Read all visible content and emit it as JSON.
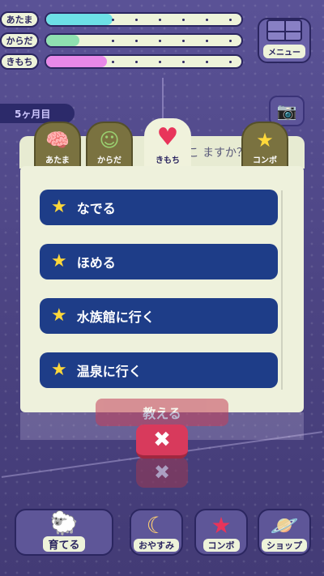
{
  "stats": [
    {
      "label": "あたま",
      "fill": 0.34,
      "color": "#6de0e6"
    },
    {
      "label": "からだ",
      "fill": 0.17,
      "color": "#8fe0b0"
    },
    {
      "label": "きもち",
      "fill": 0.31,
      "color": "#e888e8"
    }
  ],
  "menu": {
    "label": "メニュー",
    "icon": "grid-icon"
  },
  "month": {
    "label": "5ヶ月目"
  },
  "camera": {
    "icon": "camera-icon"
  },
  "question": {
    "text": "こ    ますか？"
  },
  "tabs": [
    {
      "label": "あたま",
      "icon": "brain-icon",
      "glyph": "🧠",
      "active": false
    },
    {
      "label": "からだ",
      "icon": "face-icon",
      "glyph": "☺",
      "active": false
    },
    {
      "label": "きもち",
      "icon": "heart-icon",
      "glyph": "♥",
      "active": true
    },
    {
      "label": "コンボ",
      "icon": "stars-icon",
      "glyph": "★",
      "active": false
    }
  ],
  "options": [
    {
      "label": "なでる",
      "icon": "star-icon"
    },
    {
      "label": "ほめる",
      "icon": "star-icon"
    },
    {
      "label": "水族館に行く",
      "icon": "star-icon"
    },
    {
      "label": "温泉に行く",
      "icon": "star-icon"
    }
  ],
  "teach_button": {
    "label": "教える"
  },
  "close": {
    "glyph": "✖"
  },
  "nav": [
    {
      "label": "育てる",
      "icon": "pet-icon",
      "glyph": "🐑"
    },
    {
      "label": "おやすみ",
      "icon": "moon-icon",
      "glyph": "☾"
    },
    {
      "label": "コンボ",
      "icon": "stars-icon",
      "glyph": "★"
    },
    {
      "label": "ショップ",
      "icon": "planet-icon",
      "glyph": "🪐"
    }
  ]
}
